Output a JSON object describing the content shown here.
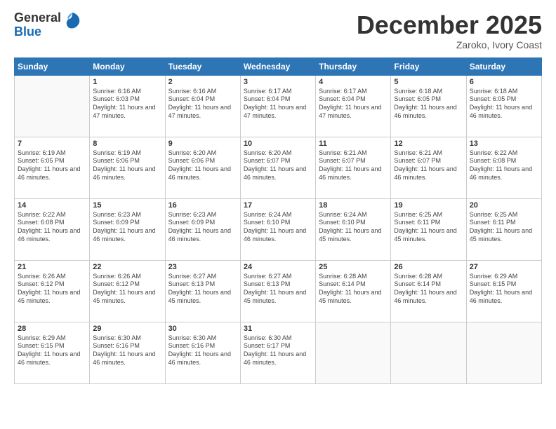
{
  "logo": {
    "general": "General",
    "blue": "Blue"
  },
  "header": {
    "month": "December 2025",
    "location": "Zaroko, Ivory Coast"
  },
  "weekdays": [
    "Sunday",
    "Monday",
    "Tuesday",
    "Wednesday",
    "Thursday",
    "Friday",
    "Saturday"
  ],
  "weeks": [
    [
      {
        "day": "",
        "sunrise": "",
        "sunset": "",
        "daylight": ""
      },
      {
        "day": "1",
        "sunrise": "Sunrise: 6:16 AM",
        "sunset": "Sunset: 6:03 PM",
        "daylight": "Daylight: 11 hours and 47 minutes."
      },
      {
        "day": "2",
        "sunrise": "Sunrise: 6:16 AM",
        "sunset": "Sunset: 6:04 PM",
        "daylight": "Daylight: 11 hours and 47 minutes."
      },
      {
        "day": "3",
        "sunrise": "Sunrise: 6:17 AM",
        "sunset": "Sunset: 6:04 PM",
        "daylight": "Daylight: 11 hours and 47 minutes."
      },
      {
        "day": "4",
        "sunrise": "Sunrise: 6:17 AM",
        "sunset": "Sunset: 6:04 PM",
        "daylight": "Daylight: 11 hours and 47 minutes."
      },
      {
        "day": "5",
        "sunrise": "Sunrise: 6:18 AM",
        "sunset": "Sunset: 6:05 PM",
        "daylight": "Daylight: 11 hours and 46 minutes."
      },
      {
        "day": "6",
        "sunrise": "Sunrise: 6:18 AM",
        "sunset": "Sunset: 6:05 PM",
        "daylight": "Daylight: 11 hours and 46 minutes."
      }
    ],
    [
      {
        "day": "7",
        "sunrise": "Sunrise: 6:19 AM",
        "sunset": "Sunset: 6:05 PM",
        "daylight": "Daylight: 11 hours and 46 minutes."
      },
      {
        "day": "8",
        "sunrise": "Sunrise: 6:19 AM",
        "sunset": "Sunset: 6:06 PM",
        "daylight": "Daylight: 11 hours and 46 minutes."
      },
      {
        "day": "9",
        "sunrise": "Sunrise: 6:20 AM",
        "sunset": "Sunset: 6:06 PM",
        "daylight": "Daylight: 11 hours and 46 minutes."
      },
      {
        "day": "10",
        "sunrise": "Sunrise: 6:20 AM",
        "sunset": "Sunset: 6:07 PM",
        "daylight": "Daylight: 11 hours and 46 minutes."
      },
      {
        "day": "11",
        "sunrise": "Sunrise: 6:21 AM",
        "sunset": "Sunset: 6:07 PM",
        "daylight": "Daylight: 11 hours and 46 minutes."
      },
      {
        "day": "12",
        "sunrise": "Sunrise: 6:21 AM",
        "sunset": "Sunset: 6:07 PM",
        "daylight": "Daylight: 11 hours and 46 minutes."
      },
      {
        "day": "13",
        "sunrise": "Sunrise: 6:22 AM",
        "sunset": "Sunset: 6:08 PM",
        "daylight": "Daylight: 11 hours and 46 minutes."
      }
    ],
    [
      {
        "day": "14",
        "sunrise": "Sunrise: 6:22 AM",
        "sunset": "Sunset: 6:08 PM",
        "daylight": "Daylight: 11 hours and 46 minutes."
      },
      {
        "day": "15",
        "sunrise": "Sunrise: 6:23 AM",
        "sunset": "Sunset: 6:09 PM",
        "daylight": "Daylight: 11 hours and 46 minutes."
      },
      {
        "day": "16",
        "sunrise": "Sunrise: 6:23 AM",
        "sunset": "Sunset: 6:09 PM",
        "daylight": "Daylight: 11 hours and 46 minutes."
      },
      {
        "day": "17",
        "sunrise": "Sunrise: 6:24 AM",
        "sunset": "Sunset: 6:10 PM",
        "daylight": "Daylight: 11 hours and 46 minutes."
      },
      {
        "day": "18",
        "sunrise": "Sunrise: 6:24 AM",
        "sunset": "Sunset: 6:10 PM",
        "daylight": "Daylight: 11 hours and 45 minutes."
      },
      {
        "day": "19",
        "sunrise": "Sunrise: 6:25 AM",
        "sunset": "Sunset: 6:11 PM",
        "daylight": "Daylight: 11 hours and 45 minutes."
      },
      {
        "day": "20",
        "sunrise": "Sunrise: 6:25 AM",
        "sunset": "Sunset: 6:11 PM",
        "daylight": "Daylight: 11 hours and 45 minutes."
      }
    ],
    [
      {
        "day": "21",
        "sunrise": "Sunrise: 6:26 AM",
        "sunset": "Sunset: 6:12 PM",
        "daylight": "Daylight: 11 hours and 45 minutes."
      },
      {
        "day": "22",
        "sunrise": "Sunrise: 6:26 AM",
        "sunset": "Sunset: 6:12 PM",
        "daylight": "Daylight: 11 hours and 45 minutes."
      },
      {
        "day": "23",
        "sunrise": "Sunrise: 6:27 AM",
        "sunset": "Sunset: 6:13 PM",
        "daylight": "Daylight: 11 hours and 45 minutes."
      },
      {
        "day": "24",
        "sunrise": "Sunrise: 6:27 AM",
        "sunset": "Sunset: 6:13 PM",
        "daylight": "Daylight: 11 hours and 45 minutes."
      },
      {
        "day": "25",
        "sunrise": "Sunrise: 6:28 AM",
        "sunset": "Sunset: 6:14 PM",
        "daylight": "Daylight: 11 hours and 45 minutes."
      },
      {
        "day": "26",
        "sunrise": "Sunrise: 6:28 AM",
        "sunset": "Sunset: 6:14 PM",
        "daylight": "Daylight: 11 hours and 46 minutes."
      },
      {
        "day": "27",
        "sunrise": "Sunrise: 6:29 AM",
        "sunset": "Sunset: 6:15 PM",
        "daylight": "Daylight: 11 hours and 46 minutes."
      }
    ],
    [
      {
        "day": "28",
        "sunrise": "Sunrise: 6:29 AM",
        "sunset": "Sunset: 6:15 PM",
        "daylight": "Daylight: 11 hours and 46 minutes."
      },
      {
        "day": "29",
        "sunrise": "Sunrise: 6:30 AM",
        "sunset": "Sunset: 6:16 PM",
        "daylight": "Daylight: 11 hours and 46 minutes."
      },
      {
        "day": "30",
        "sunrise": "Sunrise: 6:30 AM",
        "sunset": "Sunset: 6:16 PM",
        "daylight": "Daylight: 11 hours and 46 minutes."
      },
      {
        "day": "31",
        "sunrise": "Sunrise: 6:30 AM",
        "sunset": "Sunset: 6:17 PM",
        "daylight": "Daylight: 11 hours and 46 minutes."
      },
      {
        "day": "",
        "sunrise": "",
        "sunset": "",
        "daylight": ""
      },
      {
        "day": "",
        "sunrise": "",
        "sunset": "",
        "daylight": ""
      },
      {
        "day": "",
        "sunrise": "",
        "sunset": "",
        "daylight": ""
      }
    ]
  ]
}
